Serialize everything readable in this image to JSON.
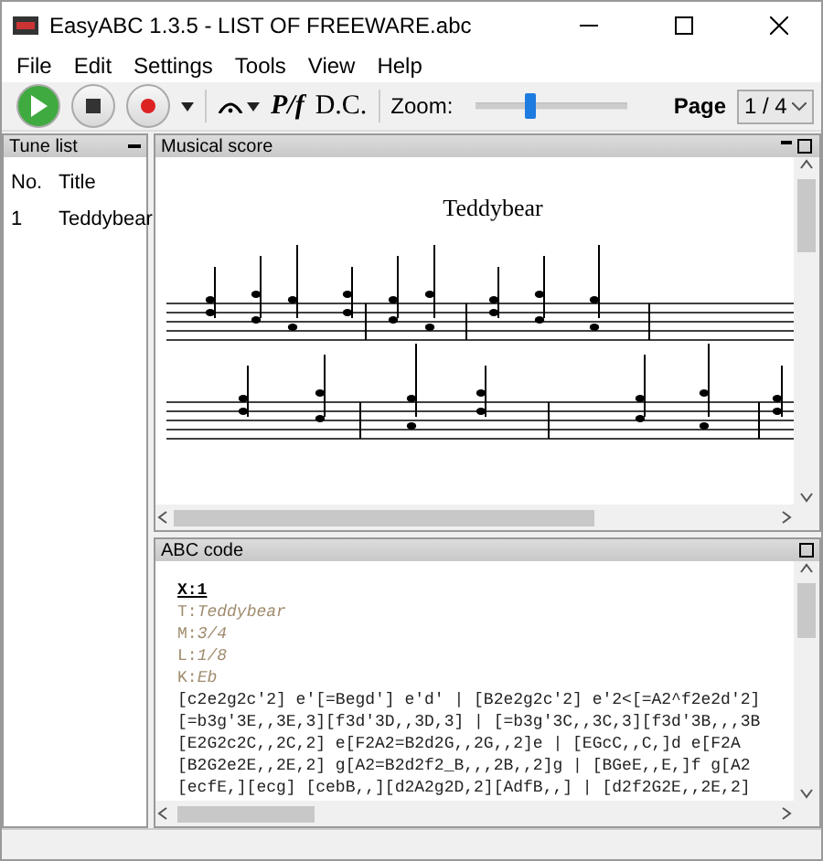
{
  "window": {
    "title": "EasyABC 1.3.5 - LIST OF FREEWARE.abc"
  },
  "menu": [
    "File",
    "Edit",
    "Settings",
    "Tools",
    "View",
    "Help"
  ],
  "toolbar": {
    "dynamics": "P/f",
    "dc": "D.C.",
    "zoom_label": "Zoom:",
    "zoom": {
      "level": 0.36
    },
    "page_label": "Page",
    "page": "1 / 4"
  },
  "tune_list": {
    "title": "Tune list",
    "columns": [
      "No.",
      "Title"
    ],
    "rows": [
      {
        "no": "1",
        "title": "Teddybear",
        "selected": false
      }
    ]
  },
  "score": {
    "title": "Musical score",
    "tune_title": "Teddybear"
  },
  "abc": {
    "title": "ABC code",
    "lines": [
      {
        "kind": "ref",
        "text": "X:1"
      },
      {
        "kind": "header",
        "text": "T:*Teddybear*"
      },
      {
        "kind": "header",
        "text": "M:*3/4*"
      },
      {
        "kind": "header",
        "text": "L:*1/8*"
      },
      {
        "kind": "header",
        "text": "K:*Eb*"
      },
      {
        "kind": "music",
        "text": "[c2e2g2c'2] e'[=Begd'] e'd' | [B2e2g2c'2] e'2<[=A2^f2e2d'2]"
      },
      {
        "kind": "music",
        "text": "[=b3g'3E,,3E,3][f3d'3D,,3D,3] | [=b3g'3C,,3C,3][f3d'3B,,,3B"
      },
      {
        "kind": "music",
        "text": "[E2G2c2C,,2C,2] e[F2A2=B2d2G,,2G,,2]e | [EGcC,,C,]d e[F2A"
      },
      {
        "kind": "music",
        "text": "[B2G2e2E,,2E,2] g[A2=B2d2f2_B,,,2B,,2]g | [BGeE,,E,]f g[A2"
      },
      {
        "kind": "music",
        "text": "[ecfE,][ecg] [cebB,,][d2A2g2D,2][AdfB,,] | [d2f2G2E,,2E,2]"
      }
    ]
  }
}
